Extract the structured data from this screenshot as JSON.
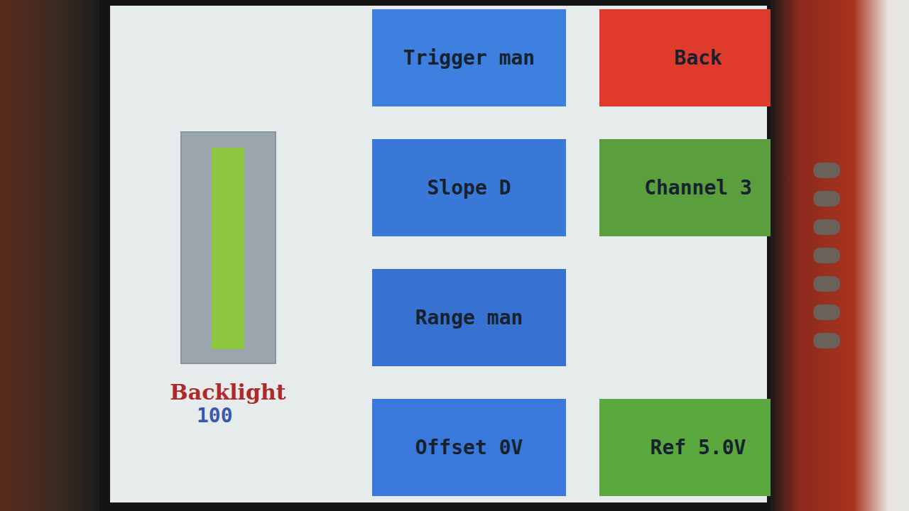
{
  "mode_buttons": [
    {
      "label": "Trigger man",
      "color": "#3d80e0"
    },
    {
      "label": "Slope D",
      "color": "#3a78d8"
    },
    {
      "label": "Range man",
      "color": "#3872d0"
    },
    {
      "label": "Offset 0V",
      "color": "#3a78dc"
    }
  ],
  "side_buttons": [
    {
      "label": "Back",
      "color": "#e03a2c"
    },
    {
      "label": "Channel 3",
      "color": "#5a9e3e"
    },
    {
      "label": "Ref 5.0V",
      "color": "#5aa83e"
    }
  ],
  "backlight": {
    "label": "Backlight",
    "reading": "100",
    "level": 1.0
  }
}
